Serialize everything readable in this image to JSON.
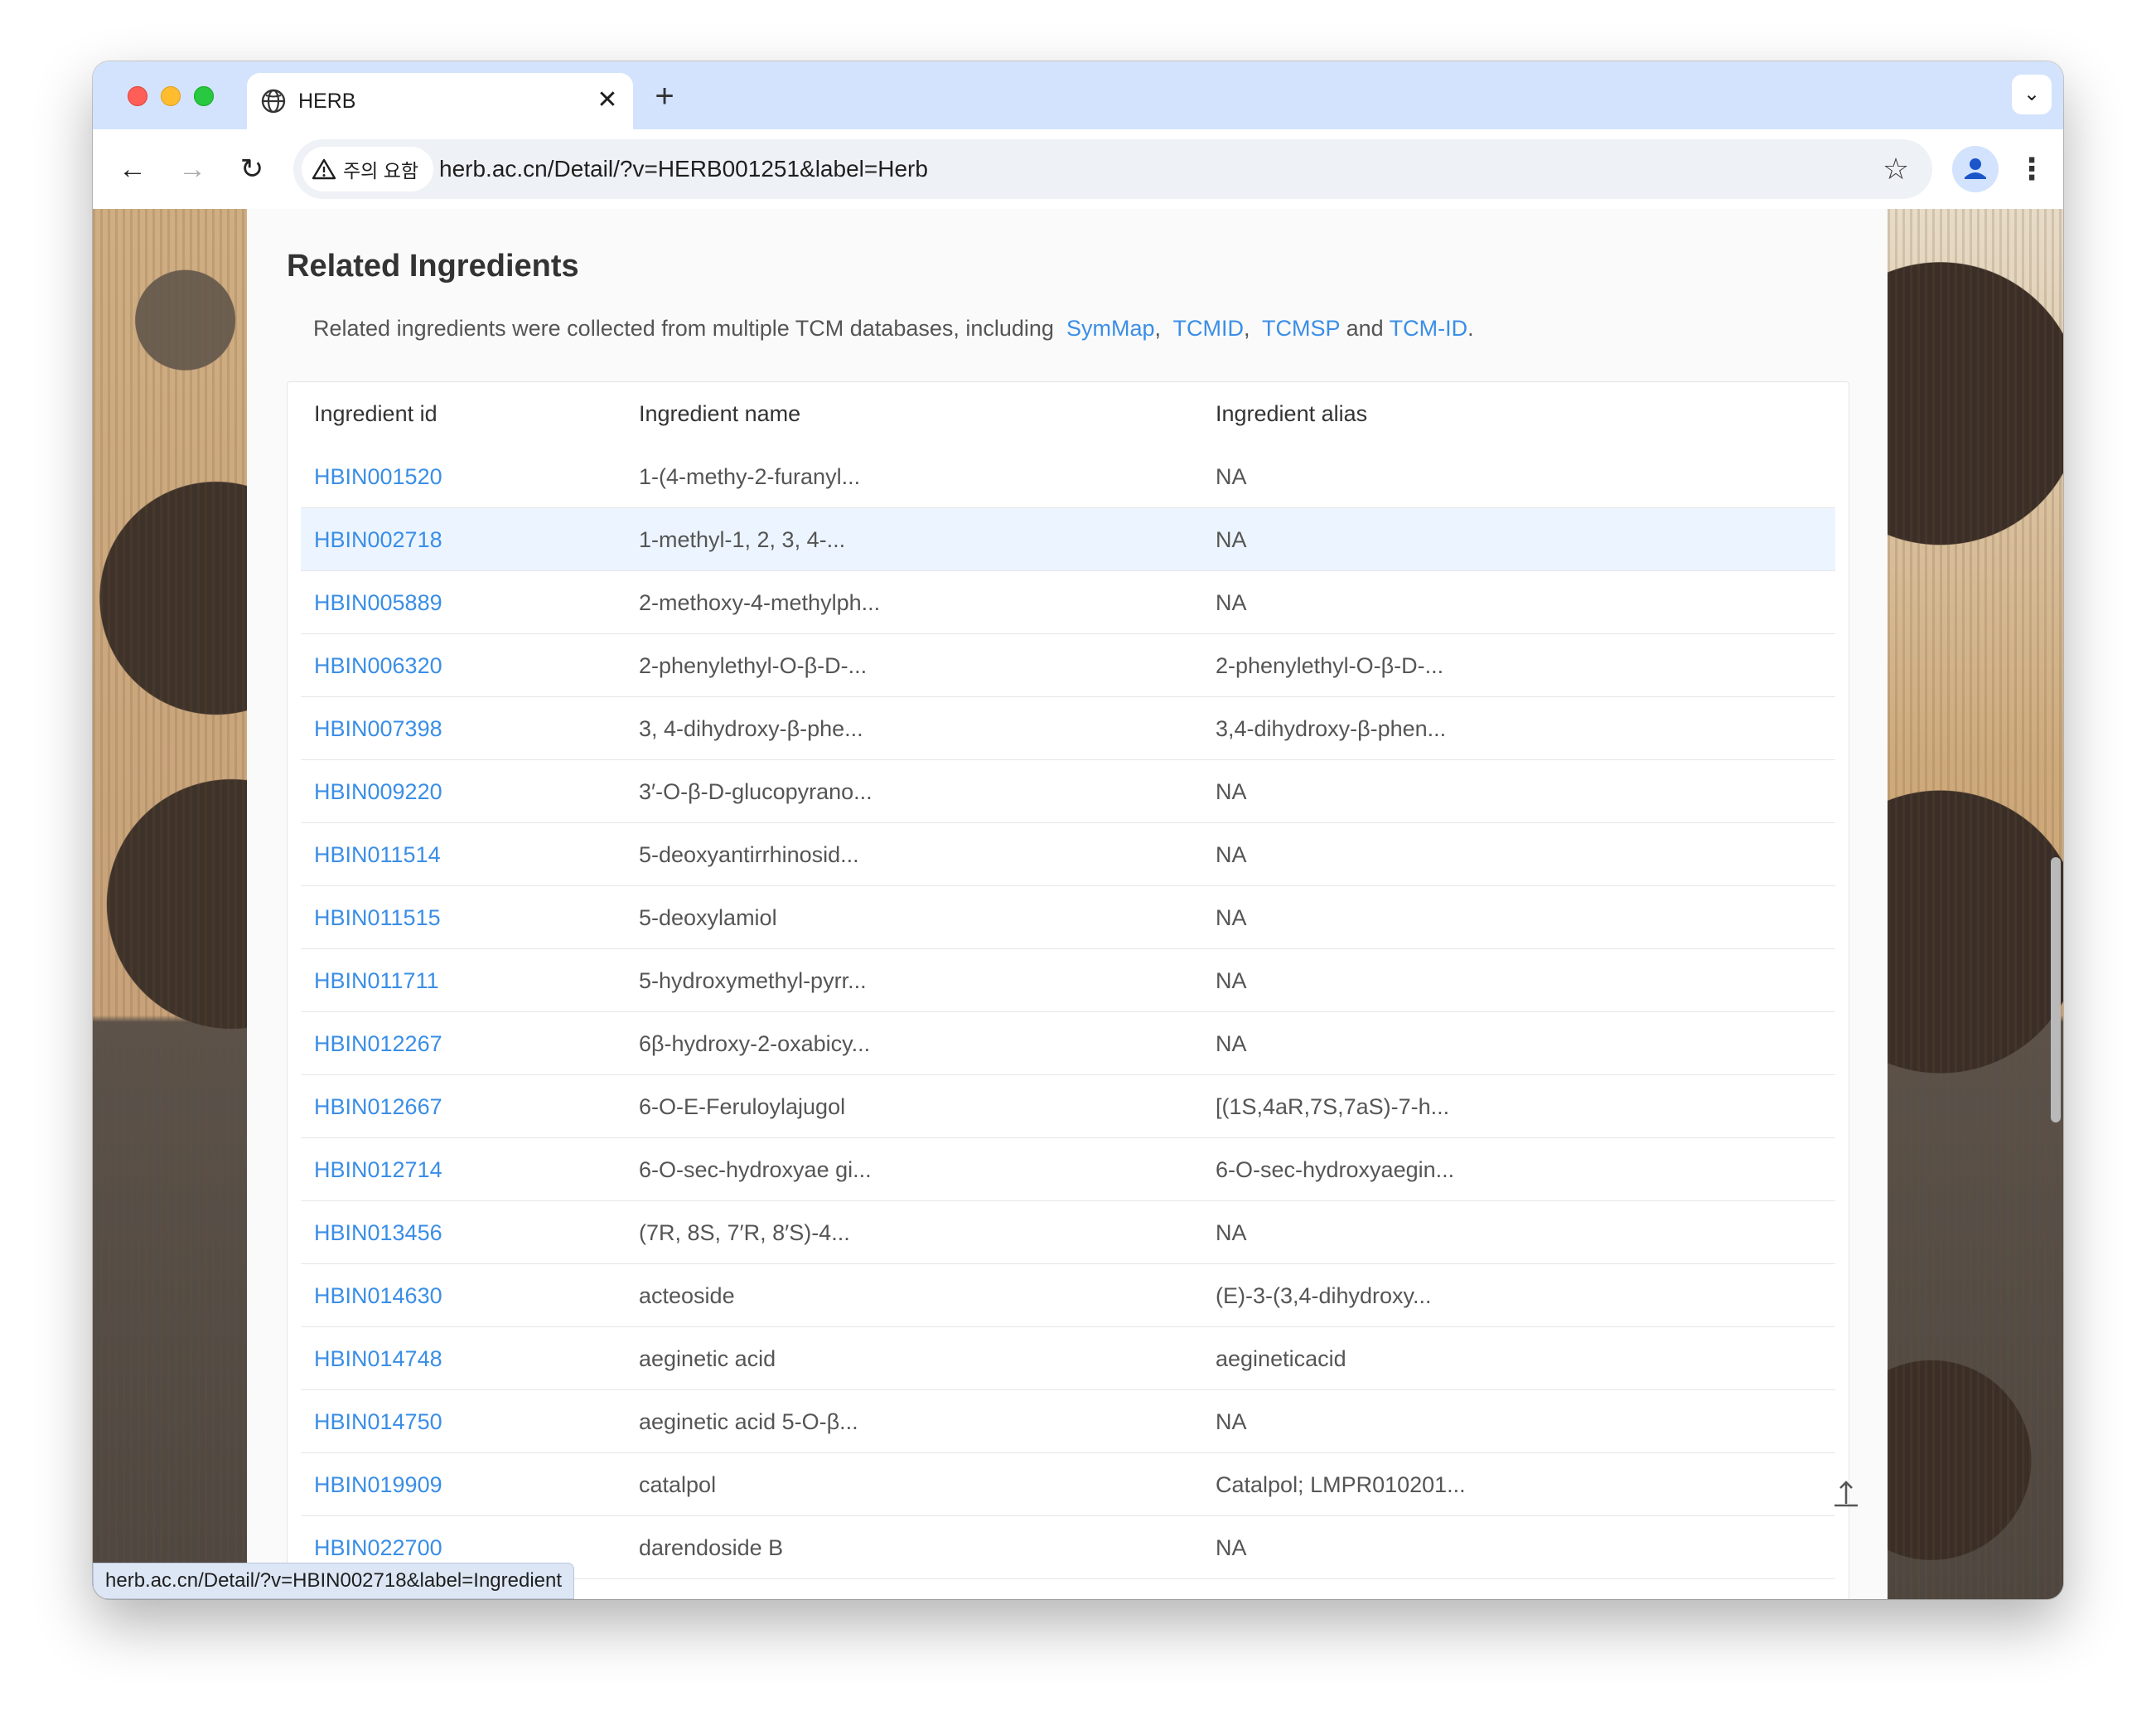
{
  "browser": {
    "tab_title": "HERB",
    "new_tab_label": "+",
    "security_label": "주의 요함",
    "url": "herb.ac.cn/Detail/?v=HERB001251&label=Herb",
    "status_url": "herb.ac.cn/Detail/?v=HBIN002718&label=Ingredient"
  },
  "section": {
    "title": "Related Ingredients",
    "intro_text": "Related ingredients were collected from multiple TCM databases, including",
    "sources": [
      "SymMap",
      "TCMID",
      "TCMSP",
      "TCM-ID"
    ],
    "sep_comma": ",",
    "sep_and": "and",
    "end_period": "."
  },
  "table": {
    "headers": [
      "Ingredient id",
      "Ingredient name",
      "Ingredient alias"
    ],
    "rows": [
      {
        "id": "HBIN001520",
        "name": "1-(4-methy-2-furanyl...",
        "alias": "NA"
      },
      {
        "id": "HBIN002718",
        "name": "1-methyl-1, 2, 3, 4-...",
        "alias": "NA"
      },
      {
        "id": "HBIN005889",
        "name": "2-methoxy-4-methylph...",
        "alias": "NA"
      },
      {
        "id": "HBIN006320",
        "name": "2-phenylethyl-O-β-D-...",
        "alias": "2-phenylethyl-O-β-D-..."
      },
      {
        "id": "HBIN007398",
        "name": "3, 4-dihydroxy-β-phe...",
        "alias": "3,4-dihydroxy-β-phen..."
      },
      {
        "id": "HBIN009220",
        "name": "3′-O-β-D-glucopyrano...",
        "alias": "NA"
      },
      {
        "id": "HBIN011514",
        "name": "5-deoxyantirrhinosid...",
        "alias": "NA"
      },
      {
        "id": "HBIN011515",
        "name": "5-deoxylamiol",
        "alias": "NA"
      },
      {
        "id": "HBIN011711",
        "name": "5-hydroxymethyl-pyrr...",
        "alias": "NA"
      },
      {
        "id": "HBIN012267",
        "name": "6β-hydroxy-2-oxabicy...",
        "alias": "NA"
      },
      {
        "id": "HBIN012667",
        "name": "6-O-E-Feruloylajugol",
        "alias": "[(1S,4aR,7S,7aS)-7-h..."
      },
      {
        "id": "HBIN012714",
        "name": "6-O-sec-hydroxyae gi...",
        "alias": "6-O-sec-hydroxyaegin..."
      },
      {
        "id": "HBIN013456",
        "name": "(7R, 8S, 7′R, 8′S)-4...",
        "alias": "NA"
      },
      {
        "id": "HBIN014630",
        "name": "acteoside",
        "alias": "(E)-3-(3,4-dihydroxy..."
      },
      {
        "id": "HBIN014748",
        "name": "aeginetic acid",
        "alias": "aegineticacid"
      },
      {
        "id": "HBIN014750",
        "name": "aeginetic acid 5-O-β...",
        "alias": "NA"
      },
      {
        "id": "HBIN019909",
        "name": "catalpol",
        "alias": "Catalpol; LMPR010201..."
      },
      {
        "id": "HBIN022700",
        "name": "darendoside B",
        "alias": "NA"
      }
    ],
    "hovered_row": "HBIN002718"
  },
  "colors": {
    "link": "#3a8ee6",
    "tabstrip": "#d3e3fd",
    "row_hover": "#ecf5ff"
  },
  "icons": [
    "globe-icon",
    "close-icon",
    "back-arrow-icon",
    "forward-arrow-icon",
    "reload-icon",
    "warning-icon",
    "star-icon",
    "profile-icon",
    "kebab-menu-icon",
    "chevron-down-icon",
    "back-to-top-icon"
  ]
}
